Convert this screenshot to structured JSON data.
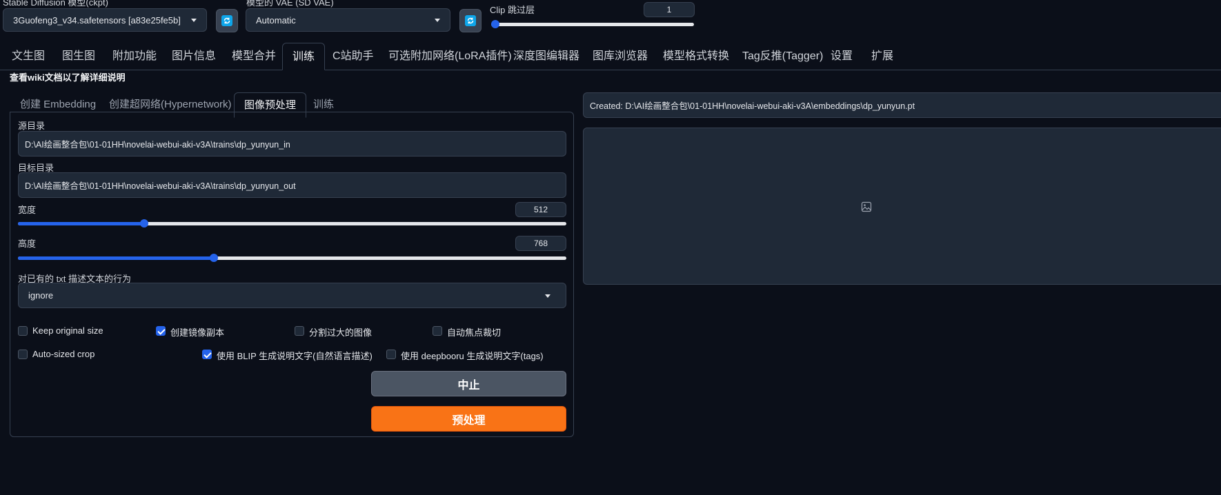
{
  "top": {
    "ckpt_label": "Stable Diffusion 模型(ckpt)",
    "ckpt_value": "3Guofeng3_v34.safetensors [a83e25fe5b]",
    "vae_label": "模型的 VAE (SD VAE)",
    "vae_value": "Automatic",
    "clip_label": "Clip 跳过层",
    "clip_value": "1",
    "clip_fraction": 0.0
  },
  "tabs": [
    "文生图",
    "图生图",
    "附加功能",
    "图片信息",
    "模型合并",
    "训练",
    "C站助手",
    "可选附加网络(LoRA插件)",
    "深度图编辑器",
    "图库浏览器",
    "模型格式转换",
    "Tag反推(Tagger)",
    "设置",
    "扩展"
  ],
  "wiki_note": "查看wiki文档以了解详细说明",
  "subtabs": [
    "创建 Embedding",
    "创建超网络(Hypernetwork)",
    "图像预处理",
    "训练"
  ],
  "form": {
    "src_label": "源目录",
    "src_value": "D:\\AI绘画整合包\\01-01HH\\novelai-webui-aki-v3A\\trains\\dp_yunyun_in",
    "dst_label": "目标目录",
    "dst_value": "D:\\AI绘画整合包\\01-01HH\\novelai-webui-aki-v3A\\trains\\dp_yunyun_out",
    "width_label": "宽度",
    "width_value": "512",
    "width_fraction": 0.23,
    "height_label": "高度",
    "height_value": "768",
    "height_fraction": 0.357,
    "txt_label": "对已有的 txt 描述文本的行为",
    "txt_value": "ignore",
    "checkboxes": [
      {
        "label": "Keep original size",
        "checked": false
      },
      {
        "label": "创建镜像副本",
        "checked": true
      },
      {
        "label": "分割过大的图像",
        "checked": false
      },
      {
        "label": "自动焦点裁切",
        "checked": false
      },
      {
        "label": "Auto-sized crop",
        "checked": false
      },
      {
        "label": "使用 BLIP 生成说明文字(自然语言描述)",
        "checked": true
      },
      {
        "label": "使用 deepbooru 生成说明文字(tags)",
        "checked": false
      }
    ],
    "stop_label": "中止",
    "run_label": "预处理"
  },
  "output": {
    "status": "Created: D:\\AI绘画整合包\\01-01HH\\novelai-webui-aki-v3A\\embeddings\\dp_yunyun.pt"
  },
  "colors": {
    "accent": "#2563eb",
    "primary_button": "#f97316",
    "background": "#0b0f19"
  }
}
